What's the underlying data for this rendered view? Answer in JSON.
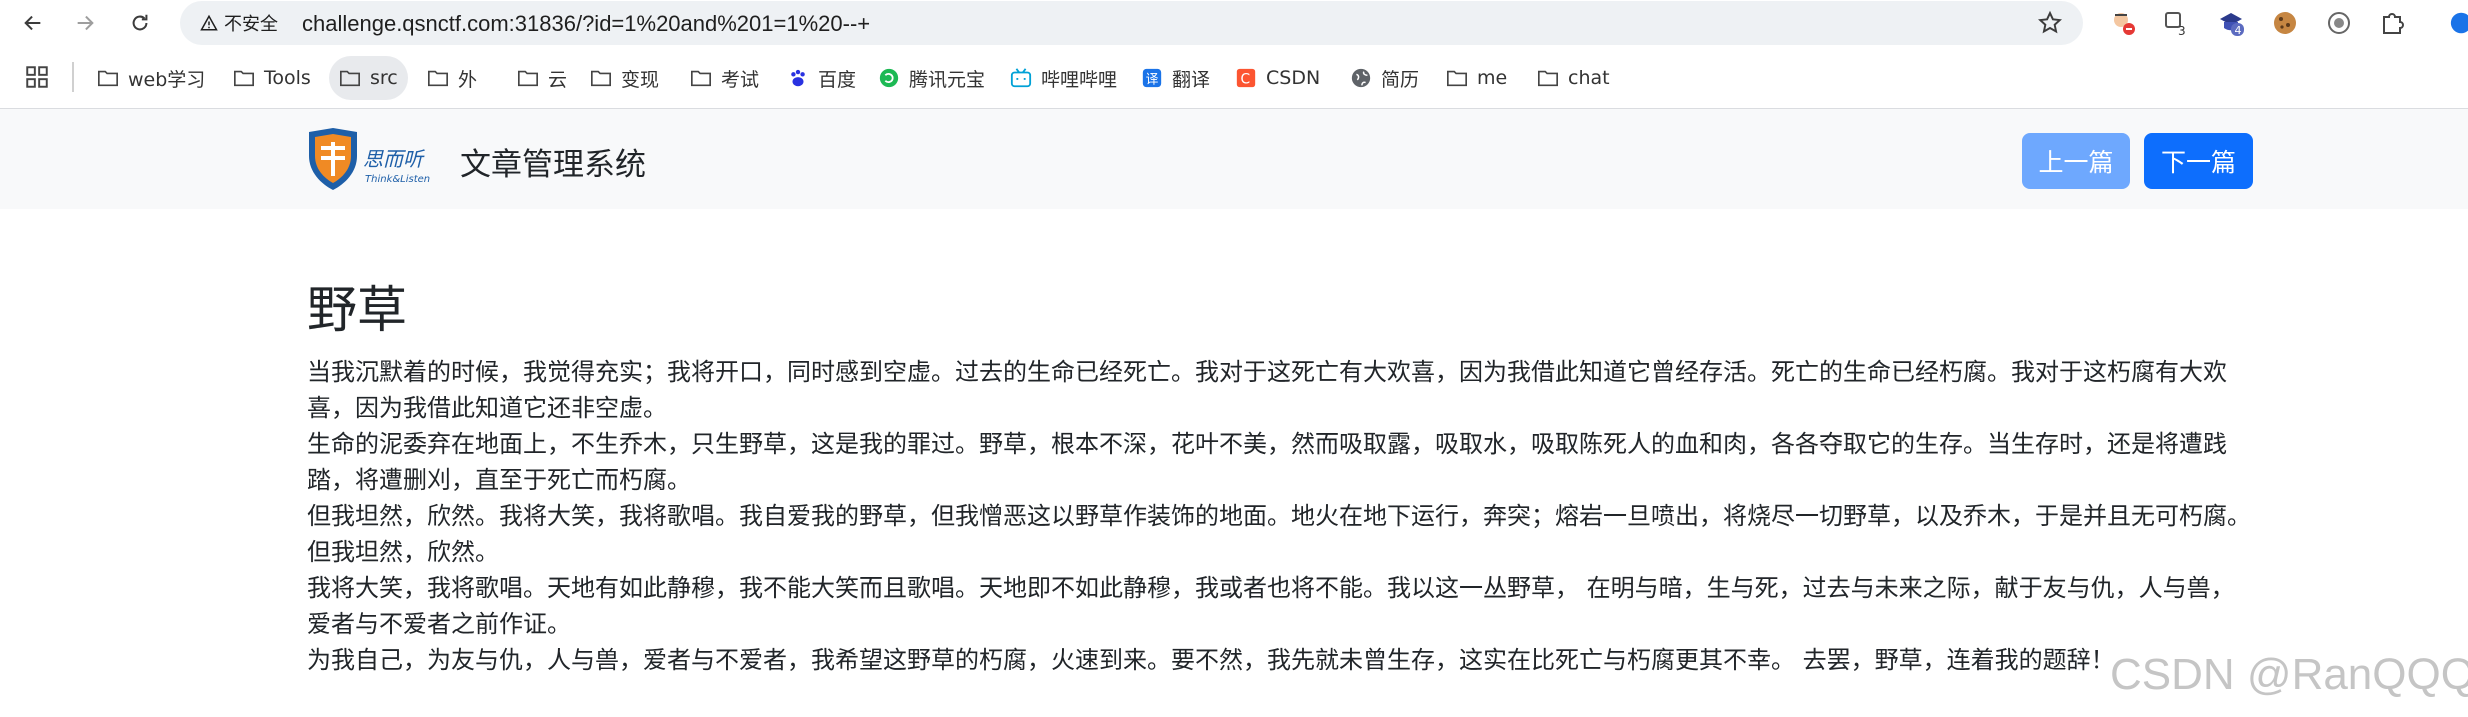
{
  "browser": {
    "security_label": "不安全",
    "url": "challenge.qsnctf.com:31836/?id=1%20and%201=1%20--+",
    "extensions": [
      {
        "name": "extension-1-icon"
      },
      {
        "name": "extension-2-icon",
        "badge": "3"
      },
      {
        "name": "extension-3-icon",
        "badge": "4"
      },
      {
        "name": "cookie-icon"
      },
      {
        "name": "extension-5-icon"
      },
      {
        "name": "puzzle-icon"
      }
    ],
    "bookmarks": [
      "web学习",
      "Tools",
      "src",
      "外",
      "云",
      "变现",
      "考试",
      "百度",
      "腾讯元宝",
      "哔哩哔哩",
      "翻译",
      "CSDN",
      "简历",
      "me",
      "chat"
    ]
  },
  "site": {
    "title": "文章管理系统",
    "logo_text": "思而听",
    "logo_sub": "Think&Listen",
    "prev_label": "上一篇",
    "next_label": "下一篇"
  },
  "article": {
    "title": "野草",
    "paragraphs": [
      "当我沉默着的时候，我觉得充实；我将开口，同时感到空虚。过去的生命已经死亡。我对于这死亡有大欢喜，因为我借此知道它曾经存活。死亡的生命已经朽腐。我对于这朽腐有大欢喜，因为我借此知道它还非空虚。",
      "生命的泥委弃在地面上，不生乔木，只生野草，这是我的罪过。野草，根本不深，花叶不美，然而吸取露，吸取水，吸取陈死人的血和肉，各各夺取它的生存。当生存时，还是将遭践踏，将遭删刈，直至于死亡而朽腐。",
      "但我坦然，欣然。我将大笑，我将歌唱。我自爱我的野草，但我憎恶这以野草作装饰的地面。地火在地下运行，奔突；熔岩一旦喷出，将烧尽一切野草，以及乔木，于是并且无可朽腐。",
      "但我坦然，欣然。",
      "我将大笑，我将歌唱。天地有如此静穆，我不能大笑而且歌唱。天地即不如此静穆，我或者也将不能。我以这一丛野草， 在明与暗，生与死，过去与未来之际，献于友与仇，人与兽，爱者与不爱者之前作证。",
      "为我自己，为友与仇，人与兽，爱者与不爱者，我希望这野草的朽腐，火速到来。要不然，我先就未曾生存，这实在比死亡与朽腐更其不幸。 去罢，野草，连着我的题辞！"
    ]
  },
  "watermark": "CSDN @RanQQQ",
  "colors": {
    "primary": "#0d6efd",
    "primary_light": "#6ea8fe",
    "header_bg": "#f8f9fa",
    "logo_blue": "#1e5fa8",
    "logo_orange": "#f08a24"
  }
}
